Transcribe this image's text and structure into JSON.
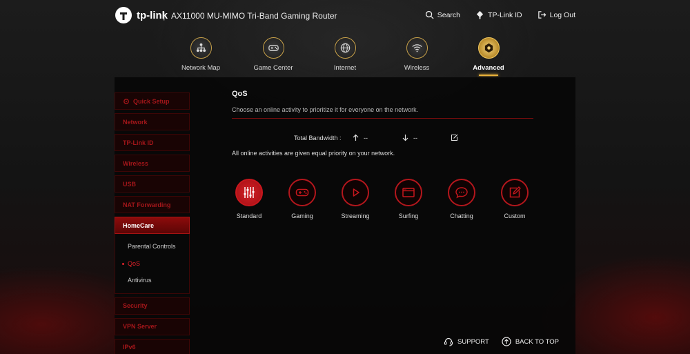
{
  "header": {
    "brand": "tp-link",
    "separator": "|",
    "device_title": "AX11000 MU-MIMO Tri-Band Gaming Router",
    "links": [
      {
        "label": "Search",
        "icon": "search-icon"
      },
      {
        "label": "TP-Link ID",
        "icon": "tplink-id-icon"
      },
      {
        "label": "Log Out",
        "icon": "logout-icon"
      }
    ]
  },
  "topnav": [
    {
      "label": "Network Map",
      "icon": "network-map-icon",
      "active": false
    },
    {
      "label": "Game Center",
      "icon": "gamepad-icon",
      "active": false
    },
    {
      "label": "Internet",
      "icon": "globe-icon",
      "active": false
    },
    {
      "label": "Wireless",
      "icon": "wifi-icon",
      "active": false
    },
    {
      "label": "Advanced",
      "icon": "advanced-gear-icon",
      "active": true
    }
  ],
  "sidebar": {
    "items": [
      {
        "label": "Quick Setup",
        "icon": "quick-setup-icon"
      },
      {
        "label": "Network"
      },
      {
        "label": "TP-Link ID"
      },
      {
        "label": "Wireless"
      },
      {
        "label": "USB"
      },
      {
        "label": "NAT Forwarding"
      },
      {
        "label": "HomeCare",
        "open": true
      },
      {
        "label": "Security"
      },
      {
        "label": "VPN Server"
      },
      {
        "label": "IPv6"
      }
    ],
    "homecare_sub": [
      {
        "label": "Parental Controls"
      },
      {
        "label": "QoS",
        "active": true
      },
      {
        "label": "Antivirus"
      }
    ]
  },
  "qos": {
    "title": "QoS",
    "subtitle": "Choose an online activity to prioritize it for everyone on the network.",
    "bandwidth_label": "Total Bandwidth :",
    "upload_value": "--",
    "download_value": "--",
    "priority_note": "All online activities are given equal priority on your network.",
    "activities": [
      {
        "label": "Standard",
        "icon": "equalizer-icon",
        "selected": true
      },
      {
        "label": "Gaming",
        "icon": "gamepad-icon",
        "selected": false
      },
      {
        "label": "Streaming",
        "icon": "play-icon",
        "selected": false
      },
      {
        "label": "Surfing",
        "icon": "browser-icon",
        "selected": false
      },
      {
        "label": "Chatting",
        "icon": "chat-bubble-icon",
        "selected": false
      },
      {
        "label": "Custom",
        "icon": "edit-icon",
        "selected": false
      }
    ]
  },
  "footer": {
    "support": "SUPPORT",
    "back_to_top": "BACK TO TOP"
  },
  "colors": {
    "accent_red": "#b3161c",
    "gold": "#e8b13a",
    "panel_bg": "#080808"
  }
}
